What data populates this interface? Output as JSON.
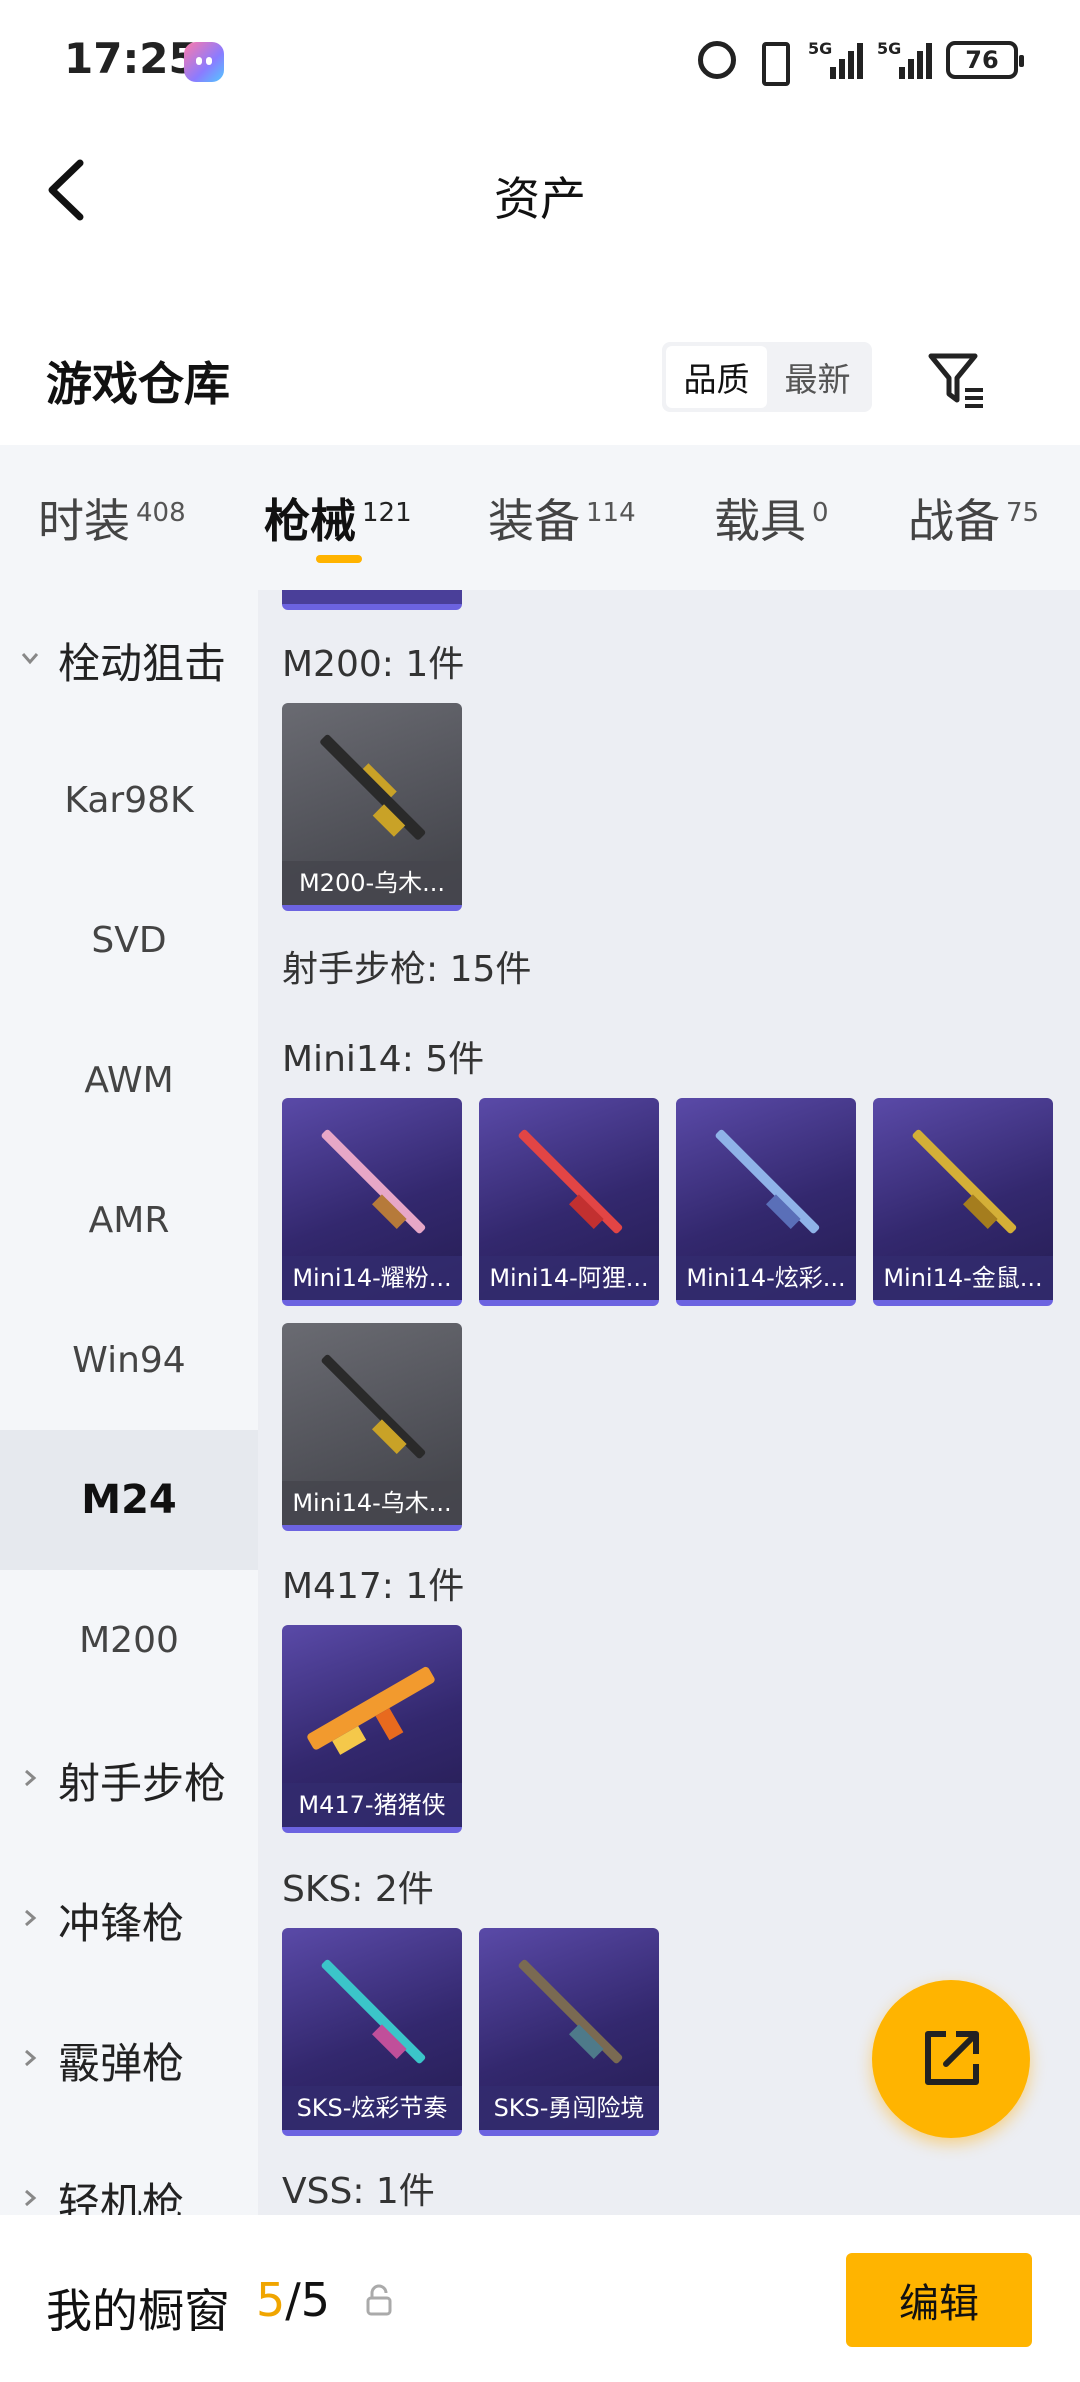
{
  "status_bar": {
    "time": "17:25",
    "signal1": "5G",
    "signal2": "5G",
    "battery": "76"
  },
  "header": {
    "title": "资产"
  },
  "warehouse": {
    "title": "游戏仓库",
    "sort_options": [
      "品质",
      "最新"
    ],
    "sort_selected": "品质"
  },
  "tabs": [
    {
      "label": "时装",
      "count": "408"
    },
    {
      "label": "枪械",
      "count": "121"
    },
    {
      "label": "装备",
      "count": "114"
    },
    {
      "label": "载具",
      "count": "0"
    },
    {
      "label": "战备",
      "count": "75"
    }
  ],
  "sidebar": {
    "group_sniper": "栓动狙击",
    "items": [
      "Kar98K",
      "SVD",
      "AWM",
      "AMR",
      "Win94",
      "M24",
      "M200"
    ],
    "group_marksman": "射手步枪",
    "group_smg": "冲锋枪",
    "group_shotgun": "霰弹枪",
    "group_lmg": "轻机枪"
  },
  "content": {
    "m200_label": "M200: 1件",
    "m200_cards": [
      "M200-乌木..."
    ],
    "marksman_label": "射手步枪: 15件",
    "mini14_label": "Mini14: 5件",
    "mini14_cards": [
      "Mini14-耀粉...",
      "Mini14-阿狸...",
      "Mini14-炫彩...",
      "Mini14-金鼠...",
      "Mini14-乌木..."
    ],
    "m417_label": "M417: 1件",
    "m417_cards": [
      "M417-猪猪侠"
    ],
    "sks_label": "SKS: 2件",
    "sks_cards": [
      "SKS-炫彩节奏",
      "SKS-勇闯险境"
    ],
    "vss_label": "VSS: 1件"
  },
  "bottom": {
    "showcase_label": "我的橱窗",
    "showcase_current": "5",
    "showcase_total": "/5",
    "edit_label": "编辑"
  },
  "colors": {
    "accent": "#ffb400",
    "card_purple": "#33286e",
    "card_gray": "#505158"
  }
}
